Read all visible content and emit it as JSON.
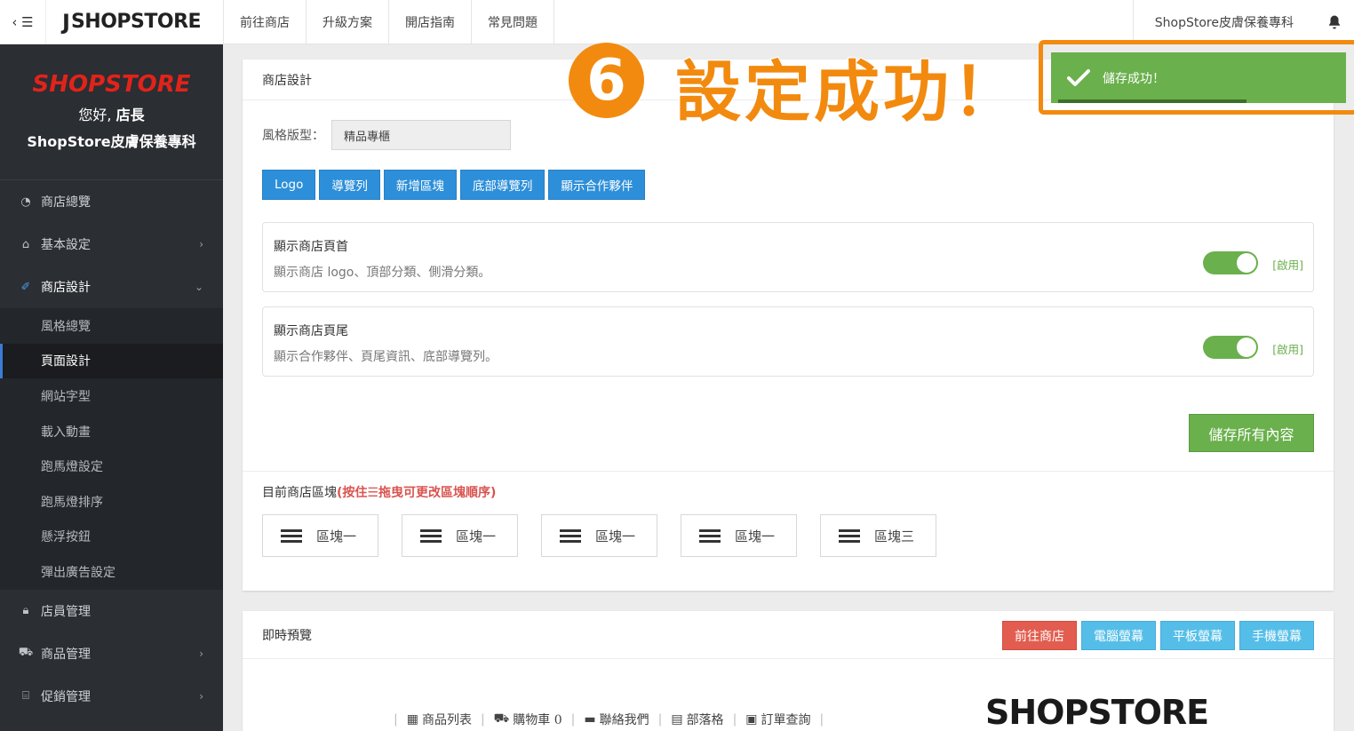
{
  "topbar": {
    "toggle_label": "‹ ☰",
    "logo_mark": "J",
    "logo_text": "SHOPSTORE",
    "nav": [
      "前往商店",
      "升級方案",
      "開店指南",
      "常見問題"
    ],
    "store_name": "ShopStore皮膚保養專科"
  },
  "sidebar": {
    "brand": "SHOPSTORE",
    "hello_prefix": "您好, ",
    "hello_name": "店長",
    "store_name": "ShopStore皮膚保養專科",
    "items": [
      {
        "label": "商店總覽",
        "icon": "dashboard-icon"
      },
      {
        "label": "基本設定",
        "icon": "bank-icon"
      },
      {
        "label": "商店設計",
        "icon": "magic-wand-icon"
      }
    ],
    "sub_items": [
      "風格總覽",
      "頁面設計",
      "網站字型",
      "載入動畫",
      "跑馬燈設定",
      "跑馬燈排序",
      "懸浮按鈕",
      "彈出廣告設定"
    ],
    "bottom_items": [
      {
        "label": "店員管理",
        "icon": "lock-icon"
      },
      {
        "label": "商品管理",
        "icon": "cart-icon"
      },
      {
        "label": "促銷管理",
        "icon": "gift-icon"
      }
    ]
  },
  "design": {
    "title": "商店設計",
    "style_label": "風格版型：",
    "style_value": "精品專櫃",
    "buttons": [
      "Logo",
      "導覽列",
      "新增區塊",
      "底部導覽列",
      "顯示合作夥伴"
    ],
    "header_toggle": {
      "title": "顯示商店頁首",
      "desc": "顯示商店 logo、頂部分類、側滑分類。",
      "state": "[啟用]"
    },
    "footer_toggle": {
      "title": "顯示商店頁尾",
      "desc": "顯示合作夥伴、頁尾資訊、底部導覽列。",
      "state": "[啟用]"
    },
    "save_label": "儲存所有內容",
    "blocks_label": "目前商店區塊",
    "blocks_hint": "(按住☰拖曳可更改區塊順序)",
    "blocks": [
      "區塊一",
      "區塊一",
      "區塊一",
      "區塊一",
      "區塊三"
    ]
  },
  "preview": {
    "title": "即時預覽",
    "buttons": [
      "前往商店",
      "電腦螢幕",
      "平板螢幕",
      "手機螢幕"
    ],
    "nav": [
      "商品列表",
      "購物車 0",
      "聯絡我們",
      "部落格",
      "訂單查詢"
    ],
    "logo_text": "SHOPSTORE"
  },
  "annotation": {
    "step": "6",
    "text": "設定成功！",
    "toast": "儲存成功！",
    "color": "#f28a0f"
  }
}
